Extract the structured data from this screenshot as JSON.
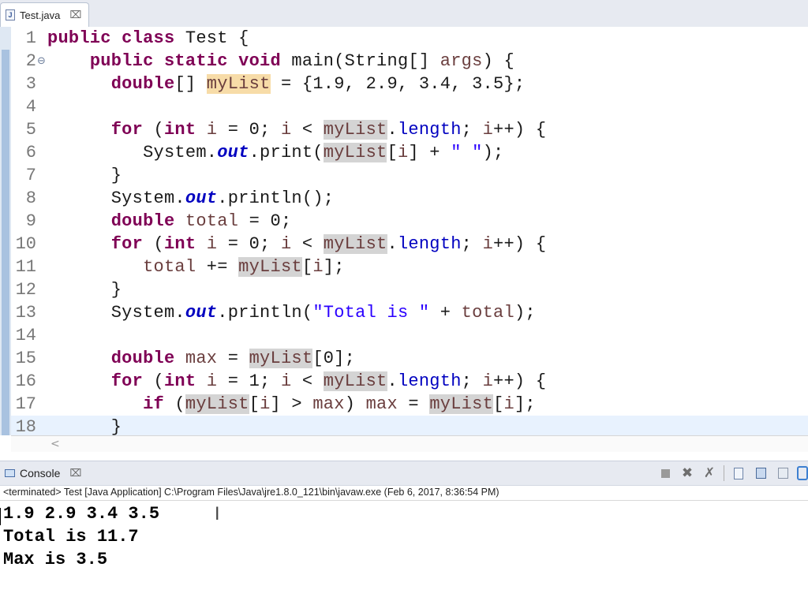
{
  "editor": {
    "tab": {
      "icon_text": "J",
      "title": "Test.java",
      "close_glyph": "⌧"
    },
    "fold_glyph": "⊖",
    "lines": [
      {
        "n": "1",
        "tokens": [
          {
            "c": "kw",
            "t": "public"
          },
          {
            "t": " "
          },
          {
            "c": "kw",
            "t": "class"
          },
          {
            "t": " Test {"
          }
        ]
      },
      {
        "n": "2",
        "fold": true,
        "tokens": [
          {
            "t": "    "
          },
          {
            "c": "kw",
            "t": "public"
          },
          {
            "t": " "
          },
          {
            "c": "kw",
            "t": "static"
          },
          {
            "t": " "
          },
          {
            "c": "kw",
            "t": "void"
          },
          {
            "t": " main(String[] "
          },
          {
            "c": "var",
            "t": "args"
          },
          {
            "t": ") {"
          }
        ]
      },
      {
        "n": "3",
        "tokens": [
          {
            "t": "      "
          },
          {
            "c": "kw",
            "t": "double"
          },
          {
            "t": "[] "
          },
          {
            "c": "var occw",
            "t": "myList"
          },
          {
            "t": " = {1.9, 2.9, 3.4, 3.5};"
          }
        ]
      },
      {
        "n": "4",
        "tokens": []
      },
      {
        "n": "5",
        "tokens": [
          {
            "t": "      "
          },
          {
            "c": "kw",
            "t": "for"
          },
          {
            "t": " ("
          },
          {
            "c": "kw",
            "t": "int"
          },
          {
            "t": " "
          },
          {
            "c": "var",
            "t": "i"
          },
          {
            "t": " = 0; "
          },
          {
            "c": "var",
            "t": "i"
          },
          {
            "t": " < "
          },
          {
            "c": "var occ",
            "t": "myList"
          },
          {
            "t": "."
          },
          {
            "c": "id",
            "t": "length"
          },
          {
            "t": "; "
          },
          {
            "c": "var",
            "t": "i"
          },
          {
            "t": "++) {"
          }
        ]
      },
      {
        "n": "6",
        "tokens": [
          {
            "t": "         System."
          },
          {
            "c": "fld",
            "t": "out"
          },
          {
            "t": ".print("
          },
          {
            "c": "var occ",
            "t": "myList"
          },
          {
            "t": "["
          },
          {
            "c": "var",
            "t": "i"
          },
          {
            "t": "] + "
          },
          {
            "c": "str",
            "t": "\" \""
          },
          {
            "t": ");"
          }
        ]
      },
      {
        "n": "7",
        "tokens": [
          {
            "t": "      }"
          }
        ]
      },
      {
        "n": "8",
        "tokens": [
          {
            "t": "      System."
          },
          {
            "c": "fld",
            "t": "out"
          },
          {
            "t": ".println();"
          }
        ]
      },
      {
        "n": "9",
        "tokens": [
          {
            "t": "      "
          },
          {
            "c": "kw",
            "t": "double"
          },
          {
            "t": " "
          },
          {
            "c": "var",
            "t": "total"
          },
          {
            "t": " = 0;"
          }
        ]
      },
      {
        "n": "10",
        "tokens": [
          {
            "t": "      "
          },
          {
            "c": "kw",
            "t": "for"
          },
          {
            "t": " ("
          },
          {
            "c": "kw",
            "t": "int"
          },
          {
            "t": " "
          },
          {
            "c": "var",
            "t": "i"
          },
          {
            "t": " = 0; "
          },
          {
            "c": "var",
            "t": "i"
          },
          {
            "t": " < "
          },
          {
            "c": "var occ",
            "t": "myList"
          },
          {
            "t": "."
          },
          {
            "c": "id",
            "t": "length"
          },
          {
            "t": "; "
          },
          {
            "c": "var",
            "t": "i"
          },
          {
            "t": "++) {"
          }
        ]
      },
      {
        "n": "11",
        "tokens": [
          {
            "t": "         "
          },
          {
            "c": "var",
            "t": "total"
          },
          {
            "t": " += "
          },
          {
            "c": "var occ",
            "t": "myList"
          },
          {
            "t": "["
          },
          {
            "c": "var",
            "t": "i"
          },
          {
            "t": "];"
          }
        ]
      },
      {
        "n": "12",
        "tokens": [
          {
            "t": "      }"
          }
        ]
      },
      {
        "n": "13",
        "tokens": [
          {
            "t": "      System."
          },
          {
            "c": "fld",
            "t": "out"
          },
          {
            "t": ".println("
          },
          {
            "c": "str",
            "t": "\"Total is \""
          },
          {
            "t": " + "
          },
          {
            "c": "var",
            "t": "total"
          },
          {
            "t": ");"
          }
        ]
      },
      {
        "n": "14",
        "tokens": []
      },
      {
        "n": "15",
        "tokens": [
          {
            "t": "      "
          },
          {
            "c": "kw",
            "t": "double"
          },
          {
            "t": " "
          },
          {
            "c": "var",
            "t": "max"
          },
          {
            "t": " = "
          },
          {
            "c": "var occ",
            "t": "myList"
          },
          {
            "t": "[0];"
          }
        ]
      },
      {
        "n": "16",
        "tokens": [
          {
            "t": "      "
          },
          {
            "c": "kw",
            "t": "for"
          },
          {
            "t": " ("
          },
          {
            "c": "kw",
            "t": "int"
          },
          {
            "t": " "
          },
          {
            "c": "var",
            "t": "i"
          },
          {
            "t": " = 1; "
          },
          {
            "c": "var",
            "t": "i"
          },
          {
            "t": " < "
          },
          {
            "c": "var occ",
            "t": "myList"
          },
          {
            "t": "."
          },
          {
            "c": "id",
            "t": "length"
          },
          {
            "t": "; "
          },
          {
            "c": "var",
            "t": "i"
          },
          {
            "t": "++) {"
          }
        ]
      },
      {
        "n": "17",
        "tokens": [
          {
            "t": "         "
          },
          {
            "c": "kw",
            "t": "if"
          },
          {
            "t": " ("
          },
          {
            "c": "var occ",
            "t": "myList"
          },
          {
            "t": "["
          },
          {
            "c": "var",
            "t": "i"
          },
          {
            "t": "] > "
          },
          {
            "c": "var",
            "t": "max"
          },
          {
            "t": ") "
          },
          {
            "c": "var",
            "t": "max"
          },
          {
            "t": " = "
          },
          {
            "c": "var occ",
            "t": "myList"
          },
          {
            "t": "["
          },
          {
            "c": "var",
            "t": "i"
          },
          {
            "t": "];"
          }
        ]
      },
      {
        "n": "18",
        "current": true,
        "tokens": [
          {
            "t": "      }"
          }
        ]
      }
    ],
    "hscroll_arrow": "<"
  },
  "console": {
    "tab": {
      "title": "Console",
      "close_glyph": "⌧"
    },
    "status": "<terminated> Test [Java Application] C:\\Program Files\\Java\\jre1.8.0_121\\bin\\javaw.exe (Feb 6, 2017, 8:36:54 PM)",
    "output": [
      "1.9 2.9 3.4 3.5",
      "Total is 11.7",
      "Max is 3.5"
    ],
    "tools": [
      "stop-icon",
      "remove-launch-icon",
      "remove-all-icon",
      "clear-console-icon",
      "scroll-lock-icon",
      "word-wrap-icon",
      "pin-console-icon"
    ]
  },
  "colors": {
    "keyword": "#7f0055",
    "string": "#2a00ff",
    "static_field": "#0000c0",
    "variable": "#6a3e3e",
    "occurrence": "#d4d4d4",
    "write_occurrence": "#f7dca8",
    "current_line": "#e8f2fe"
  }
}
